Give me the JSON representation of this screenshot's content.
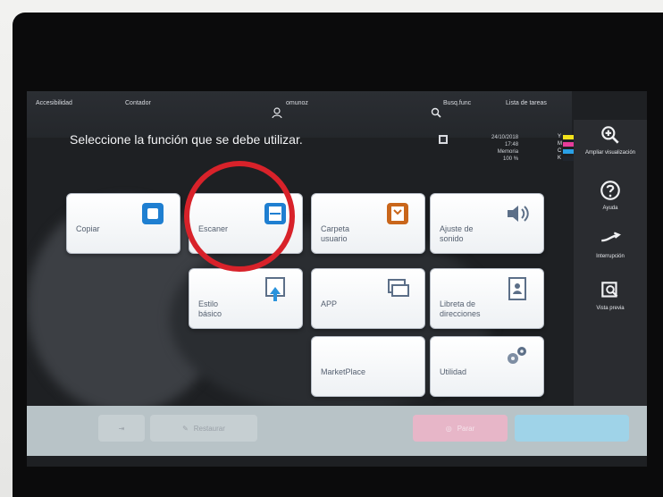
{
  "topbar": {
    "accessibility_label": "Accesibilidad",
    "counter_label": "Contador",
    "user_name": "omunoz",
    "search_label": "Busq.func",
    "task_list_label": "Lista de tareas",
    "instruction": "Seleccione la función que se debe utilizar.",
    "date": "24/10/2018",
    "time": "17:48",
    "memory_label": "Memoria",
    "memory_value": "100 %"
  },
  "toner": [
    "Y",
    "M",
    "C",
    "K"
  ],
  "side_panel": {
    "zoom_label": "Ampliar visualización",
    "help_label": "Ayuda",
    "interrupt_label": "Interrupción",
    "preview_label": "Vista previa"
  },
  "tiles": {
    "copy": "Copiar",
    "scan": "Escaner",
    "user_box_l1": "Carpeta",
    "user_box_l2": "usuario",
    "sound_l1": "Ajuste de",
    "sound_l2": "sonido",
    "basic_style_l1": "Estilo",
    "basic_style_l2": "básico",
    "app": "APP",
    "address_l1": "Libreta de",
    "address_l2": "direcciones",
    "marketplace": "MarketPlace",
    "utility": "Utilidad"
  },
  "bottom": {
    "restore": "Restaurar",
    "stop": "Parar"
  },
  "colors": {
    "highlight_circle": "#d8222a",
    "accent_blue": "#1f7fd1",
    "stop_pink": "#e7b6c8",
    "start_blue": "#9fd3e8"
  }
}
